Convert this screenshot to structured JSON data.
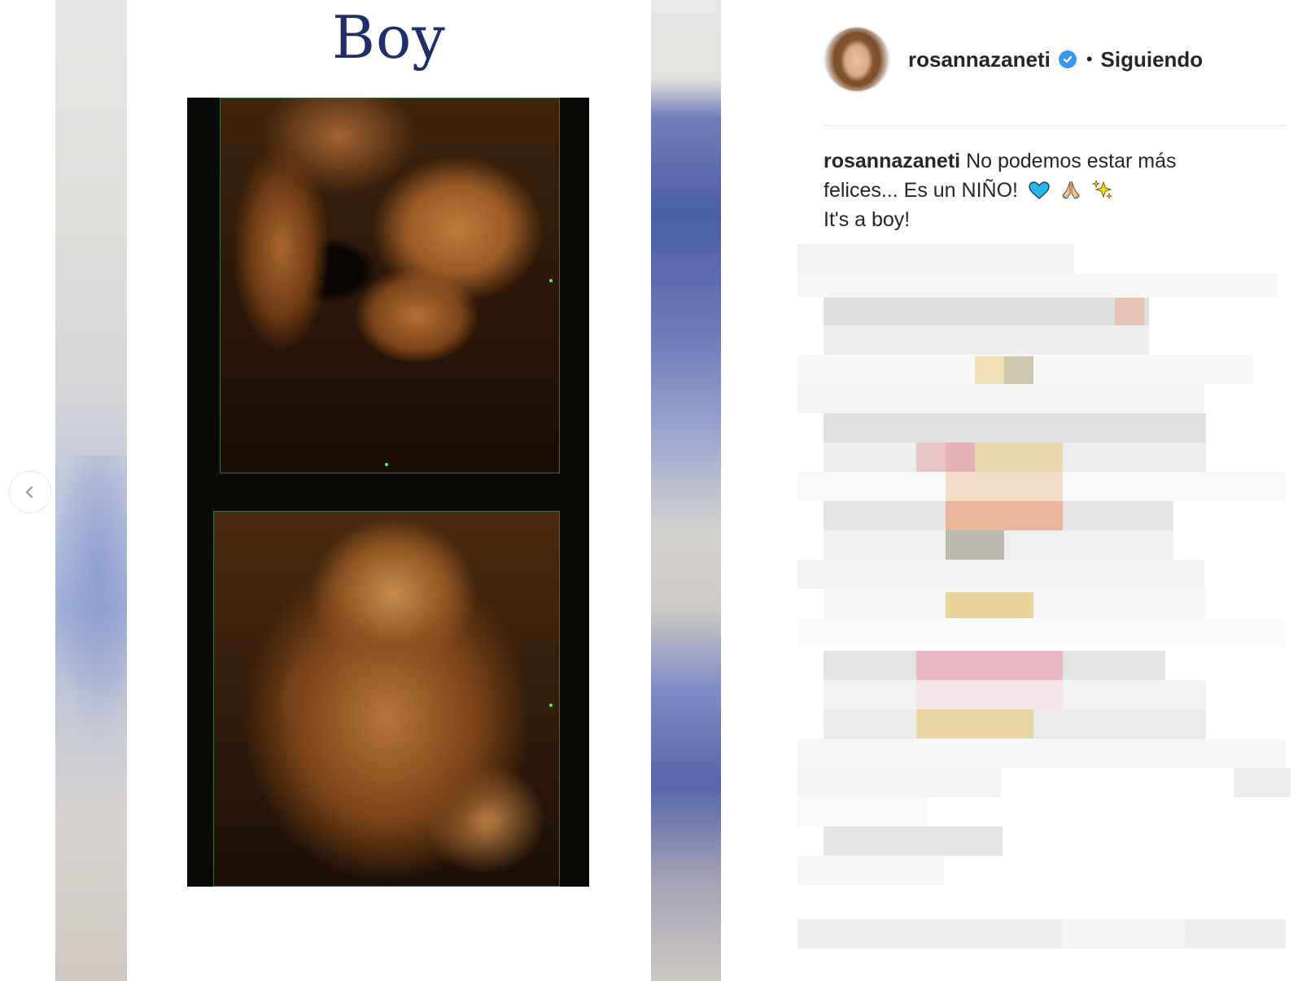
{
  "media": {
    "title": "Boy",
    "icons": {
      "prev": "chevron-left-icon"
    }
  },
  "post": {
    "username": "rosannazaneti",
    "separator": "•",
    "follow_status": "Siguiendo",
    "caption_user": "rosannazaneti",
    "caption_line1": "No podemos estar más felices... Es un NIÑO!",
    "caption_line2": "It's a boy!",
    "caption_emojis": [
      "blue-heart-icon",
      "praying-hands-icon",
      "sparkles-icon"
    ],
    "verified_icon": "verified-badge-icon"
  },
  "colors": {
    "title_ink": "#1f2f6b",
    "verified_blue": "#3897f0",
    "text": "#262626",
    "divider": "#e6e6e6"
  }
}
